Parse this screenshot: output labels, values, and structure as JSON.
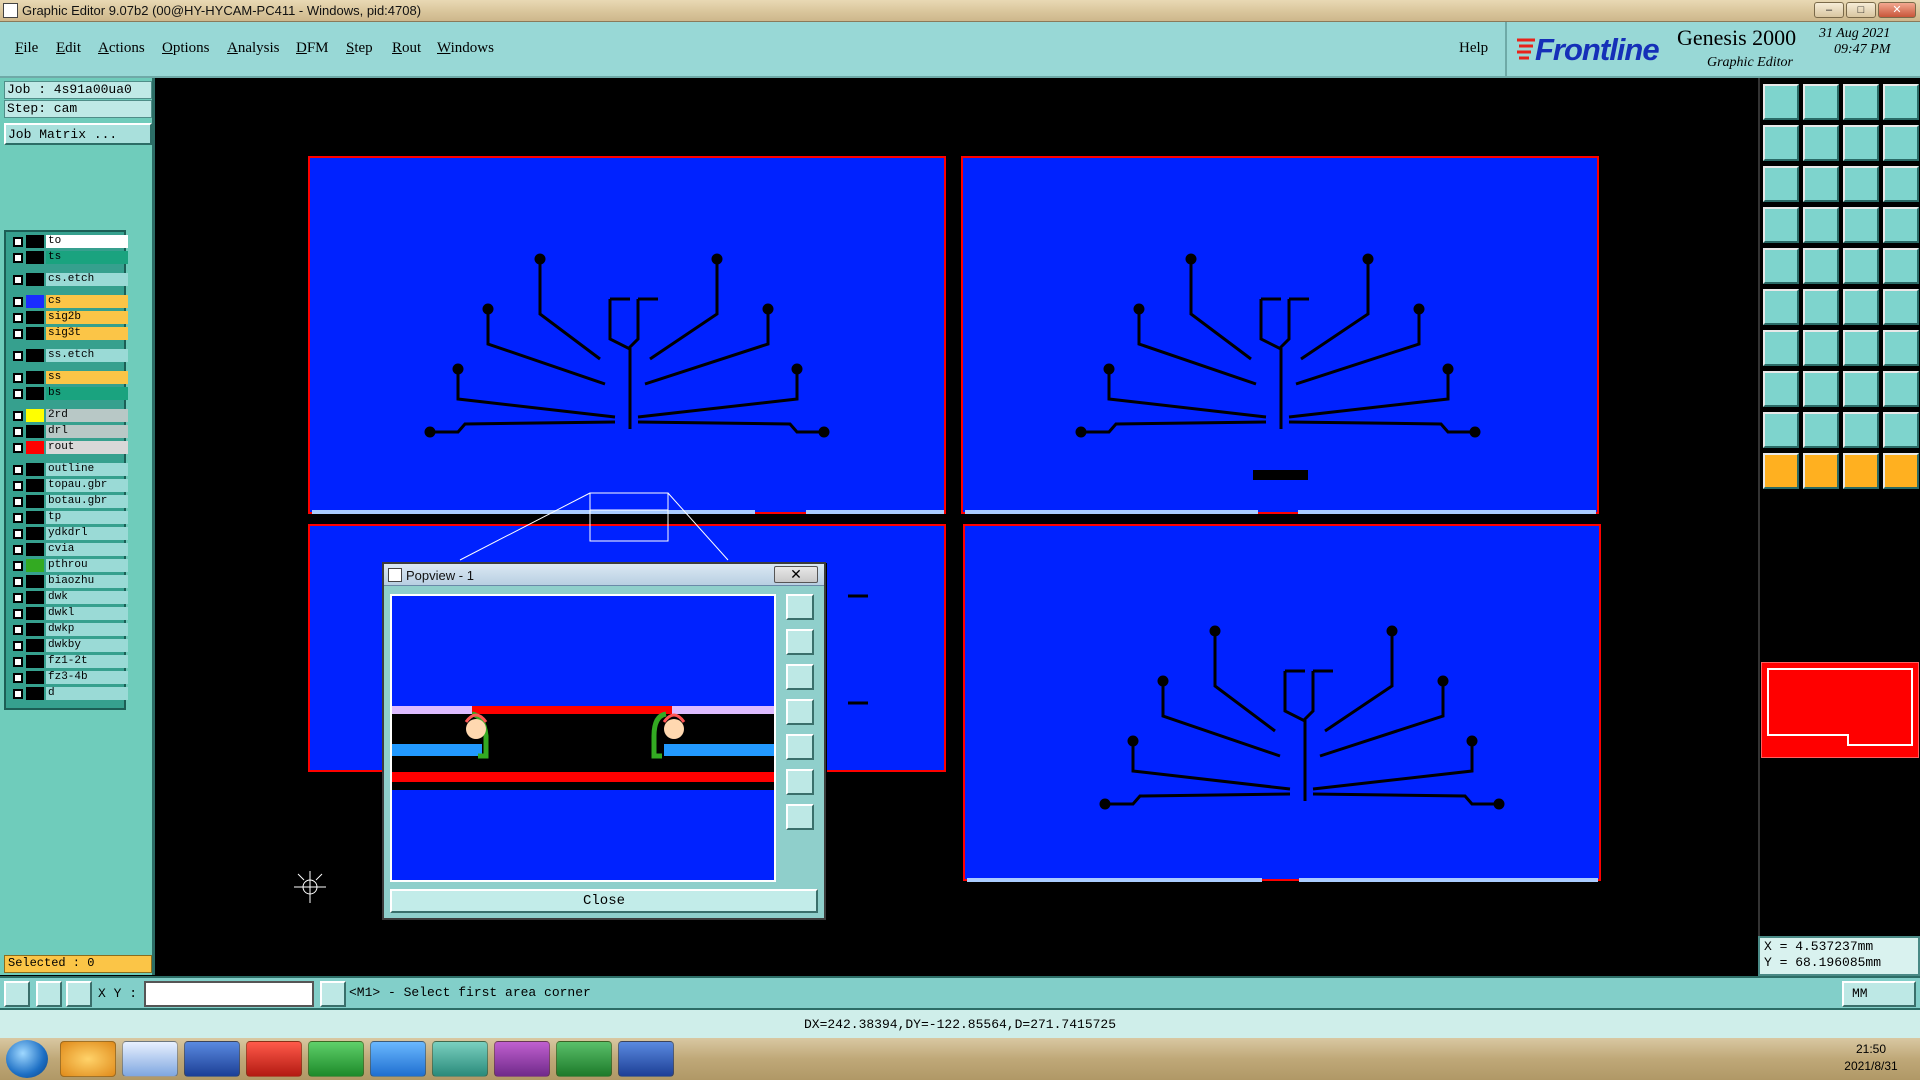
{
  "window": {
    "title": "Graphic Editor 9.07b2 (00@HY-HYCAM-PC411 - Windows, pid:4708)",
    "min": "–",
    "max": "□",
    "close": "✕"
  },
  "menu": [
    {
      "label": "File",
      "u": "F",
      "rest": "ile"
    },
    {
      "label": "Edit",
      "u": "E",
      "rest": "dit"
    },
    {
      "label": "Actions",
      "u": "A",
      "rest": "ctions"
    },
    {
      "label": "Options",
      "u": "O",
      "rest": "ptions"
    },
    {
      "label": "Analysis",
      "u": "A",
      "rest": "nalysis"
    },
    {
      "label": "DFM",
      "u": "D",
      "rest": "FM"
    },
    {
      "label": "Step",
      "u": "S",
      "rest": "tep"
    },
    {
      "label": "Rout",
      "u": "R",
      "rest": "out"
    },
    {
      "label": "Windows",
      "u": "W",
      "rest": "indows"
    }
  ],
  "help_label": "Help",
  "brand": {
    "logo": "Frontline",
    "product": "Genesis 2000",
    "subtitle": "Graphic Editor",
    "date": "31 Aug 2021",
    "time": "09:47 PM"
  },
  "job": {
    "job_label": "Job : 4s91a00ua0",
    "step_label": "Step: cam",
    "matrix_button": "Job Matrix ..."
  },
  "layers": [
    {
      "name": "to",
      "color": "#000000",
      "bg": "#ffffff"
    },
    {
      "name": "ts",
      "color": "#000000",
      "bg": "#1aa37f"
    },
    {
      "name": "cs.etch",
      "color": "#000000",
      "bg": "#9adad6"
    },
    {
      "name": "cs",
      "color": "#1a2cff",
      "bg": "#fbc547"
    },
    {
      "name": "sig2b",
      "color": "#000000",
      "bg": "#fbc547"
    },
    {
      "name": "sig3t",
      "color": "#000000",
      "bg": "#fbc547"
    },
    {
      "name": "ss.etch",
      "color": "#000000",
      "bg": "#9adad6"
    },
    {
      "name": "ss",
      "color": "#000000",
      "bg": "#fbc547"
    },
    {
      "name": "bs",
      "color": "#000000",
      "bg": "#1aa37f"
    },
    {
      "name": "2rd",
      "color": "#ffff00",
      "bg": "#b8c8c6"
    },
    {
      "name": "drl",
      "color": "#000000",
      "bg": "#b8c8c6"
    },
    {
      "name": "rout",
      "color": "#ff0000",
      "bg": "#d8d8d8"
    },
    {
      "name": "outline",
      "color": "#000000",
      "bg": "#9adad6"
    },
    {
      "name": "topau.gbr",
      "color": "#000000",
      "bg": "#9adad6"
    },
    {
      "name": "botau.gbr",
      "color": "#000000",
      "bg": "#9adad6"
    },
    {
      "name": "tp",
      "color": "#000000",
      "bg": "#9adad6"
    },
    {
      "name": "ydkdrl",
      "color": "#000000",
      "bg": "#9adad6"
    },
    {
      "name": "cvia",
      "color": "#000000",
      "bg": "#9adad6"
    },
    {
      "name": "pthrou",
      "color": "#33aa22",
      "bg": "#9adad6"
    },
    {
      "name": "biaozhu",
      "color": "#000000",
      "bg": "#9adad6"
    },
    {
      "name": "dwk",
      "color": "#000000",
      "bg": "#9adad6"
    },
    {
      "name": "dwkl",
      "color": "#000000",
      "bg": "#9adad6"
    },
    {
      "name": "dwkp",
      "color": "#000000",
      "bg": "#9adad6"
    },
    {
      "name": "dwkby",
      "color": "#000000",
      "bg": "#9adad6"
    },
    {
      "name": "fz1-2t",
      "color": "#000000",
      "bg": "#9adad6"
    },
    {
      "name": "fz3-4b",
      "color": "#000000",
      "bg": "#9adad6"
    },
    {
      "name": "d",
      "color": "#000000",
      "bg": "#9adad6"
    }
  ],
  "selected_label": "Selected : 0",
  "popview": {
    "title": "Popview - 1",
    "close_x": "✕",
    "close_button": "Close"
  },
  "coords": {
    "x": "X = 4.537237mm",
    "y": "Y = 68.196085mm"
  },
  "cmd": {
    "xy_label": "X Y :",
    "xy_value": "",
    "prompt": "<M1> - Select first area corner",
    "units": "MM"
  },
  "status": "DX=242.38394,DY=-122.85564,D=271.7415725",
  "clock": {
    "time": "21:50",
    "date": "2021/8/31"
  },
  "colors": {
    "board": "#0022ff",
    "outline": "#ff0000",
    "panel": "#6fccbb",
    "menu": "#98d8d6",
    "accent": "#fbc547"
  }
}
